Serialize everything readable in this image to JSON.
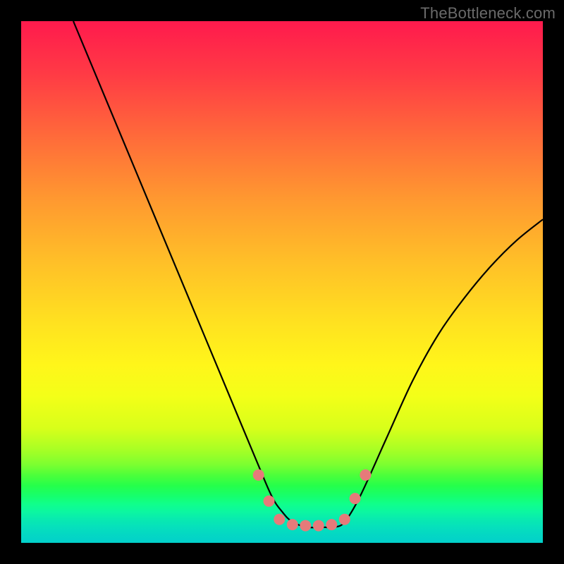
{
  "watermark": "TheBottleneck.com",
  "chart_data": {
    "type": "line",
    "title": "",
    "xlabel": "",
    "ylabel": "",
    "xlim": [
      0,
      100
    ],
    "ylim": [
      0,
      100
    ],
    "series": [
      {
        "name": "curve",
        "x": [
          10,
          15,
          20,
          25,
          30,
          35,
          40,
          45,
          48,
          50,
          52,
          55,
          58,
          60,
          62,
          65,
          70,
          75,
          80,
          85,
          90,
          95,
          100
        ],
        "values": [
          100,
          88,
          76,
          64,
          52,
          40,
          28,
          16,
          9,
          6,
          4,
          3,
          3,
          3,
          4,
          9,
          20,
          31,
          40,
          47,
          53,
          58,
          62
        ]
      }
    ],
    "markers": [
      {
        "x": 45.5,
        "y": 13,
        "r": 8,
        "color": "#e67a7a"
      },
      {
        "x": 47.5,
        "y": 8,
        "r": 8,
        "color": "#e67a7a"
      },
      {
        "x": 49.5,
        "y": 4.5,
        "r": 8,
        "color": "#e67a7a"
      },
      {
        "x": 52,
        "y": 3.5,
        "r": 8,
        "color": "#e67a7a"
      },
      {
        "x": 54.5,
        "y": 3.3,
        "r": 8,
        "color": "#e67a7a"
      },
      {
        "x": 57,
        "y": 3.3,
        "r": 8,
        "color": "#e67a7a"
      },
      {
        "x": 59.5,
        "y": 3.5,
        "r": 8,
        "color": "#e67a7a"
      },
      {
        "x": 62,
        "y": 4.5,
        "r": 8,
        "color": "#e67a7a"
      },
      {
        "x": 64,
        "y": 8.5,
        "r": 8,
        "color": "#e67a7a"
      },
      {
        "x": 66,
        "y": 13,
        "r": 8,
        "color": "#e67a7a"
      }
    ],
    "curve_stroke": "#000000",
    "curve_width": 2.2
  }
}
